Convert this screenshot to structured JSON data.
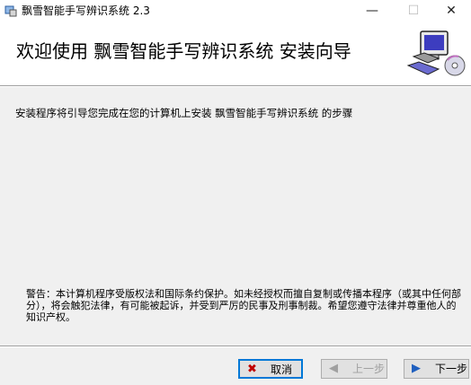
{
  "window": {
    "title": "飘雪智能手写辨识系统 2.3",
    "minimize": "—",
    "maximize": "☐",
    "close": "✕"
  },
  "header": {
    "title": "欢迎使用  飘雪智能手写辨识系统  安装向导"
  },
  "body": {
    "intro": "安装程序将引导您完成在您的计算机上安装  飘雪智能手写辨识系统  的步骤",
    "warning": "警告：本计算机程序受版权法和国际条约保护。如未经授权而擅自复制或传播本程序（或其中任何部分），将会触犯法律，有可能被起诉，并受到严厉的民事及刑事制裁。希望您遵守法律并尊重他人的知识产权。"
  },
  "buttons": {
    "cancel": {
      "label": "取消",
      "icon": "close-x-icon",
      "glyph": "✖"
    },
    "back": {
      "label": "上一步",
      "icon": "arrow-left-icon",
      "glyph": "◀",
      "enabled": false
    },
    "next": {
      "label": "下一步",
      "icon": "arrow-right-icon",
      "glyph": "▶"
    }
  },
  "colors": {
    "focus": "#0078d7",
    "cancel_icon": "#c00000",
    "next_icon": "#1f5fbf"
  }
}
